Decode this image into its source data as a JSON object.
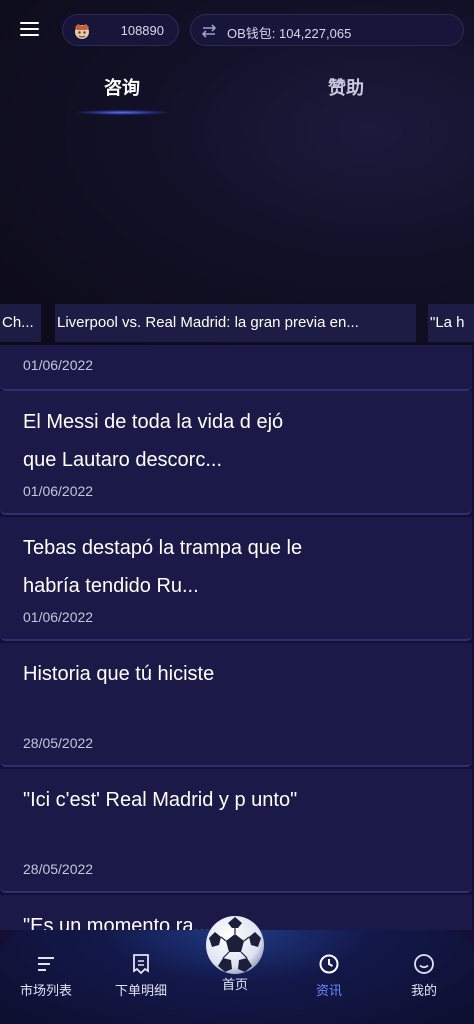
{
  "header": {
    "coins": "108890",
    "wallet": "OB钱包: 104,227,065"
  },
  "tabs": [
    {
      "label": "咨询",
      "active": true
    },
    {
      "label": "赞助",
      "active": false
    }
  ],
  "ticker": [
    "Ch...",
    "Liverpool vs. Real Madrid: la gran previa en...",
    "\"La h"
  ],
  "news": [
    {
      "title": "",
      "date": "01/06/2022"
    },
    {
      "title": "El Messi de toda la vida d ejó que Lautaro descorc...",
      "date": "01/06/2022"
    },
    {
      "title": "Tebas destapó la trampa que le habría tendido Ru...",
      "date": "01/06/2022"
    },
    {
      "title": "Historia que tú hiciste",
      "date": "28/05/2022"
    },
    {
      "title": "\"Ici c'est' Real Madrid y p unto\"",
      "date": "28/05/2022"
    },
    {
      "title": "\"Es un momento ra... en",
      "date": ""
    }
  ],
  "bottom_nav": [
    {
      "label": "市场列表",
      "icon": "market-list-icon"
    },
    {
      "label": "下单明细",
      "icon": "order-details-icon"
    },
    {
      "label": "首页",
      "icon": "soccer-ball-icon"
    },
    {
      "label": "资讯",
      "icon": "clock-icon",
      "active": true
    },
    {
      "label": "我的",
      "icon": "smiley-icon"
    }
  ],
  "colors": {
    "background": "#141034",
    "card": "#1a1947",
    "active_nav": "#6d88ff"
  }
}
